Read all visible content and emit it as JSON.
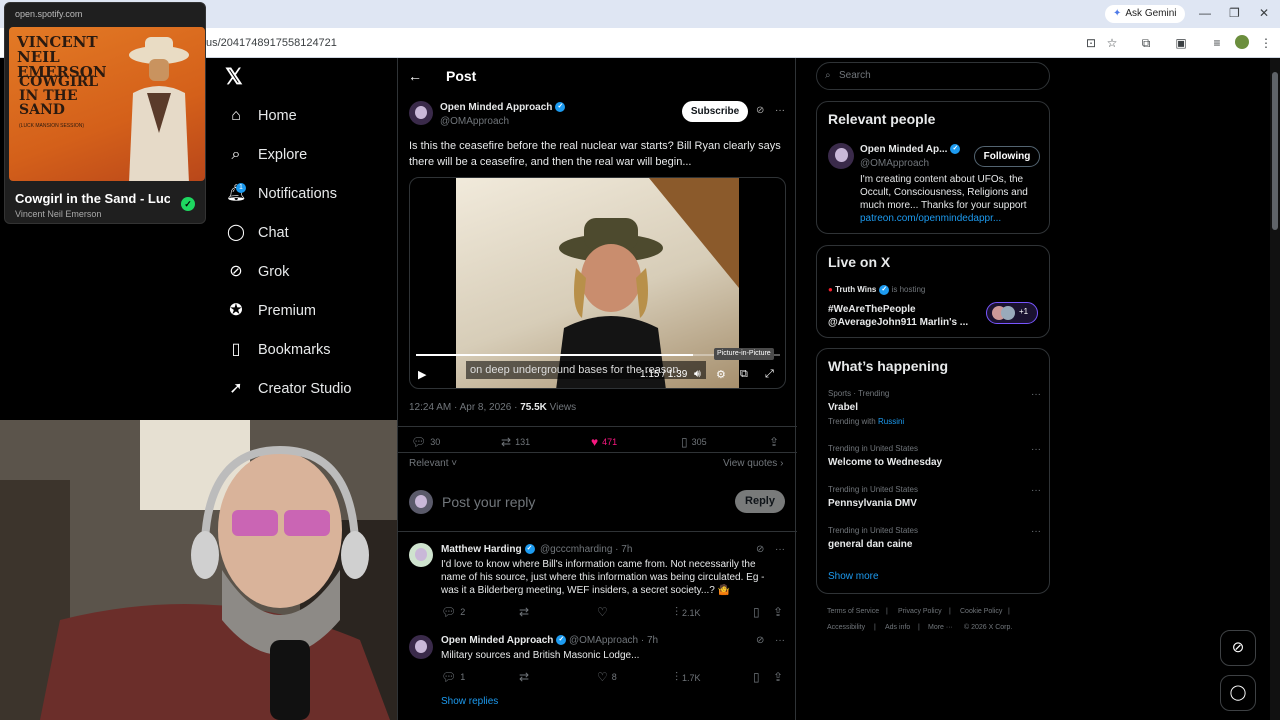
{
  "browser": {
    "url": "us/2041748917558124721",
    "gemini_label": "Ask Gemini",
    "gemini_icon": "sparkle-icon",
    "window_controls": [
      "—",
      "❐",
      "✕"
    ]
  },
  "spotify": {
    "site": "open.spotify.com",
    "cover_line1": "VINCENT NEIL EMERSON",
    "cover_line2": "COWGIRL IN THE SAND",
    "cover_line3": "(LUCK MANSION SESSION)",
    "track_title": "Cowgirl in the Sand - Luck",
    "artist": "Vincent Neil Emerson",
    "accent": "#1ed760"
  },
  "nav": {
    "logo": "𝕏",
    "items": [
      {
        "label": "Home",
        "icon": "home-icon"
      },
      {
        "label": "Explore",
        "icon": "search-icon"
      },
      {
        "label": "Notifications",
        "icon": "bell-icon"
      },
      {
        "label": "Chat",
        "icon": "chat-icon"
      },
      {
        "label": "Grok",
        "icon": "grok-icon"
      },
      {
        "label": "Premium",
        "icon": "premium-icon"
      },
      {
        "label": "Bookmarks",
        "icon": "bookmark-icon"
      },
      {
        "label": "Creator Studio",
        "icon": "rocket-icon"
      }
    ],
    "notifications_badge": "1"
  },
  "post": {
    "header_title": "Post",
    "author_name": "Open Minded Approach",
    "author_handle": "@OMApproach",
    "subscribe_label": "Subscribe",
    "text": "Is this the ceasefire before the real nuclear war starts? Bill Ryan clearly says there will be a ceasefire, and then the real war will begin...",
    "video": {
      "subtitle": "on deep underground bases for the reason",
      "time": "1:15 / 1:39",
      "progress": 0.76,
      "tooltip": "Picture-in-Picture"
    },
    "time": "12:24 AM · Apr 8, 2026 ·",
    "views_count": "75.5K",
    "views_label": "Views",
    "stats": {
      "replies": "30",
      "reposts": "131",
      "likes": "471",
      "bookmarks": "305"
    },
    "like_color": "#f91880",
    "relevant_label": "Relevant",
    "view_quotes_label": "View quotes",
    "reply_placeholder": "Post your reply",
    "reply_button": "Reply"
  },
  "replies": [
    {
      "name": "Matthew Harding",
      "handle": "@gcccmharding · 7h",
      "text": "I'd love to know where Bill's information came from. Not necessarily the name of his source, just where this information was being circulated. Eg - was it a Bilderberg meeting, WEF insiders, a secret society...? 🤷",
      "replies": "2",
      "reposts": "",
      "likes": "",
      "views": "2.1K"
    },
    {
      "name": "Open Minded Approach",
      "handle": "@OMApproach · 7h",
      "text": "Military sources and British Masonic Lodge...",
      "replies": "1",
      "reposts": "",
      "likes": "8",
      "views": "1.7K"
    }
  ],
  "show_replies_label": "Show replies",
  "sidebar": {
    "search_placeholder": "Search",
    "relevant_title": "Relevant people",
    "person_name": "Open Minded Ap...",
    "person_handle": "@OMApproach",
    "following_label": "Following",
    "bio": "I'm creating content about UFOs, the Occult, Consciousness, Religions and much more... Thanks for your support",
    "bio_link": "patreon.com/openmindedappr...",
    "live_title": "Live on X",
    "live_host": "Truth Wins",
    "live_hosting": "is hosting",
    "live_text": "#WeAreThePeople @AverageJohn911 Marlin's ...",
    "live_extra": "+1",
    "happening_title": "What’s happening",
    "trends": [
      {
        "sub": "Sports · Trending",
        "name": "Vrabel",
        "extra_prefix": "Trending with",
        "extra_link": "Russini"
      },
      {
        "sub": "Trending in United States",
        "name": "Welcome to Wednesday"
      },
      {
        "sub": "Trending in United States",
        "name": "Pennsylvania DMV"
      },
      {
        "sub": "Trending in United States",
        "name": "general dan caine"
      }
    ],
    "show_more": "Show more",
    "footer_line1": [
      "Terms of Service",
      "Privacy Policy",
      "Cookie Policy"
    ],
    "footer_line2": [
      "Accessibility",
      "Ads info",
      "More ···",
      "© 2026 X Corp."
    ]
  }
}
